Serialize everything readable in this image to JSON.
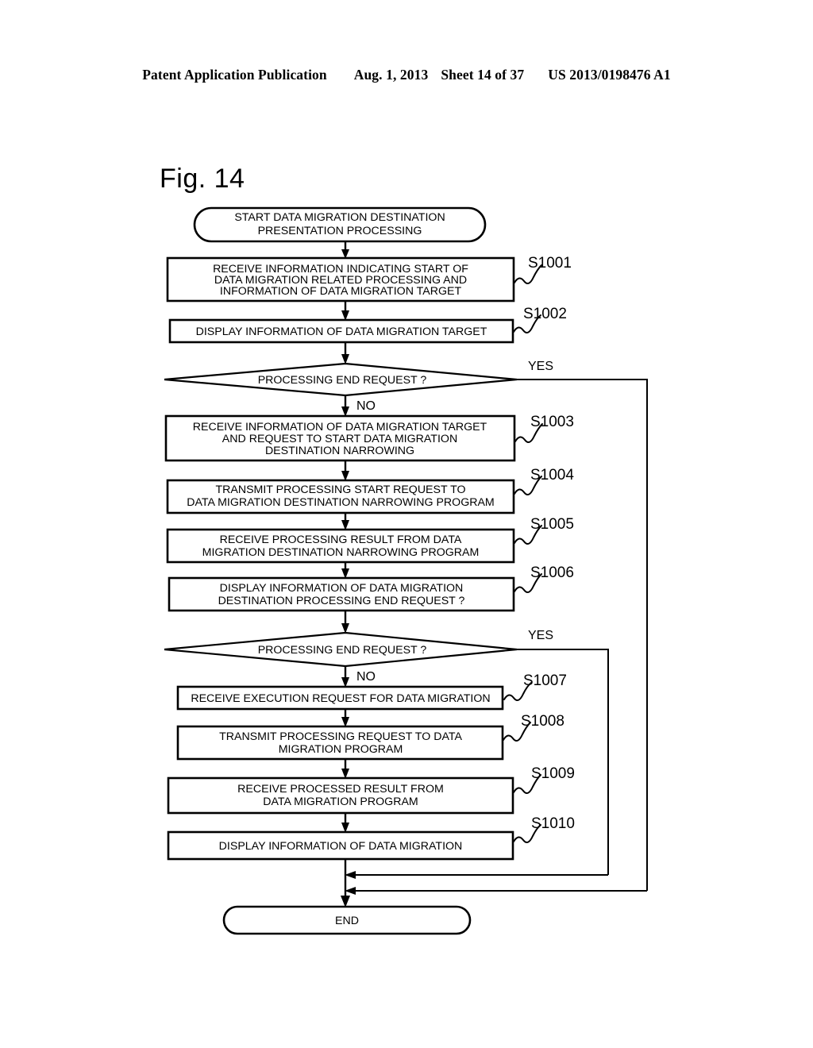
{
  "header": {
    "publication": "Patent Application Publication",
    "date": "Aug. 1, 2013",
    "sheet": "Sheet 14 of 37",
    "patent_number": "US 2013/0198476 A1"
  },
  "figure": {
    "label": "Fig. 14",
    "type": "flowchart",
    "title": "Data migration destination presentation processing"
  },
  "nodes": {
    "start": {
      "shape": "terminator",
      "line1": "START DATA MIGRATION DESTINATION",
      "line2": "PRESENTATION PROCESSING"
    },
    "s1001": {
      "shape": "process",
      "step": "S1001",
      "line1": "RECEIVE INFORMATION INDICATING START OF",
      "line2": "DATA MIGRATION RELATED PROCESSING AND",
      "line3": "INFORMATION OF DATA MIGRATION TARGET"
    },
    "s1002": {
      "shape": "process",
      "step": "S1002",
      "line1": "DISPLAY INFORMATION OF DATA MIGRATION TARGET"
    },
    "decision1": {
      "shape": "decision",
      "line1": "PROCESSING END REQUEST ?",
      "yes_label": "YES",
      "no_label": "NO"
    },
    "s1003": {
      "shape": "process",
      "step": "S1003",
      "line1": "RECEIVE INFORMATION OF DATA MIGRATION TARGET",
      "line2": "AND REQUEST TO START DATA MIGRATION",
      "line3": "DESTINATION NARROWING"
    },
    "s1004": {
      "shape": "process",
      "step": "S1004",
      "line1": "TRANSMIT PROCESSING START REQUEST TO",
      "line2": "DATA MIGRATION DESTINATION NARROWING PROGRAM"
    },
    "s1005": {
      "shape": "process",
      "step": "S1005",
      "line1": "RECEIVE PROCESSING RESULT FROM DATA",
      "line2": "MIGRATION DESTINATION NARROWING PROGRAM"
    },
    "s1006": {
      "shape": "process",
      "step": "S1006",
      "line1": "DISPLAY INFORMATION OF DATA MIGRATION",
      "line2": "DESTINATION PROCESSING END REQUEST ?"
    },
    "decision2": {
      "shape": "decision",
      "line1": "PROCESSING END REQUEST   ?",
      "yes_label": "YES",
      "no_label": "NO"
    },
    "s1007": {
      "shape": "process",
      "step": "S1007",
      "line1": "RECEIVE EXECUTION REQUEST FOR DATA MIGRATION"
    },
    "s1008": {
      "shape": "process",
      "step": "S1008",
      "line1": "TRANSMIT PROCESSING REQUEST TO DATA",
      "line2": "MIGRATION PROGRAM"
    },
    "s1009": {
      "shape": "process",
      "step": "S1009",
      "line1": "RECEIVE PROCESSED RESULT FROM",
      "line2": "DATA MIGRATION PROGRAM"
    },
    "s1010": {
      "shape": "process",
      "step": "S1010",
      "line1": "DISPLAY INFORMATION OF DATA MIGRATION"
    },
    "end": {
      "shape": "terminator",
      "line1": "END"
    }
  },
  "colors": {
    "ink": "#000000",
    "paper": "#ffffff"
  }
}
